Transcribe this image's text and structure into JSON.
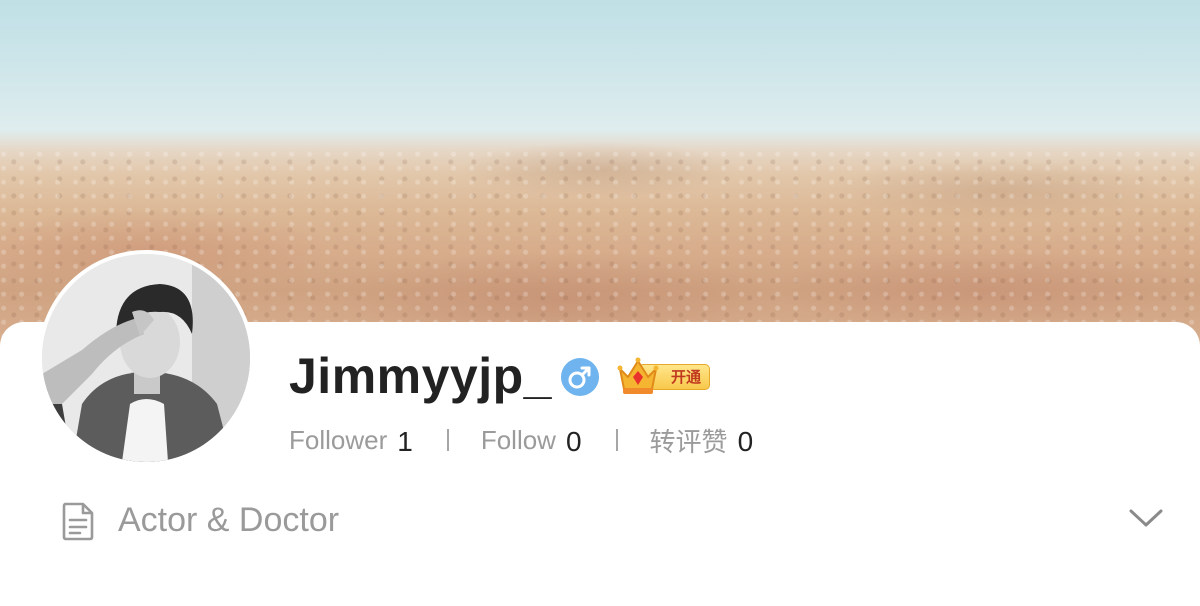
{
  "profile": {
    "username": "Jimmyyjp_",
    "gender_icon": "male-icon",
    "vip_badge_label": "开通",
    "vip_icon": "crown-icon",
    "bio": "Actor & Doctor"
  },
  "stats": [
    {
      "label": "Follower",
      "value": "1"
    },
    {
      "label": "Follow",
      "value": "0"
    },
    {
      "label": "转评赞",
      "value": "0"
    }
  ],
  "colors": {
    "accent_blue": "#6fb4ee",
    "vip_gold": "#f8c84b",
    "vip_red": "#c0391f",
    "text_dark": "#222222",
    "text_muted": "#9b9b9b"
  }
}
